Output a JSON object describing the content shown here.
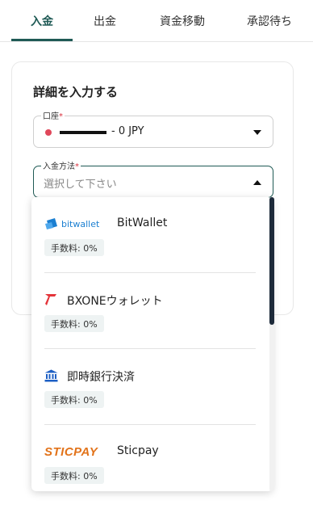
{
  "tabs": [
    {
      "label": "入金",
      "active": true
    },
    {
      "label": "出金",
      "active": false
    },
    {
      "label": "資金移動",
      "active": false
    },
    {
      "label": "承認待ち",
      "active": false
    }
  ],
  "form": {
    "title": "詳細を入力する",
    "account": {
      "label": "口座",
      "required_mark": "*",
      "value_suffix": "- 0 JPY"
    },
    "method": {
      "label": "入金方法",
      "required_mark": "*",
      "placeholder": "選択して下さい"
    }
  },
  "payment_methods": [
    {
      "name": "BitWallet",
      "logo_text": "bitwallet",
      "fee": "手数料: 0%",
      "logo_icon": "bitwallet-icon"
    },
    {
      "name": "BXONEウォレット",
      "fee": "手数料: 0%",
      "logo_icon": "bxone-icon"
    },
    {
      "name": "即時銀行決済",
      "fee": "手数料: 0%",
      "logo_icon": "bank-icon"
    },
    {
      "name": "Sticpay",
      "logo_text": "STICPAY",
      "fee": "手数料: 0%",
      "logo_icon": "sticpay-icon"
    }
  ],
  "colors": {
    "accent": "#1f5a55",
    "required": "#d9303d",
    "bitwallet": "#1b7fd1",
    "bxone": "#e4343a",
    "bank": "#1d5fc4",
    "sticpay": "#e2731a",
    "account_dot": "#e0475a"
  }
}
